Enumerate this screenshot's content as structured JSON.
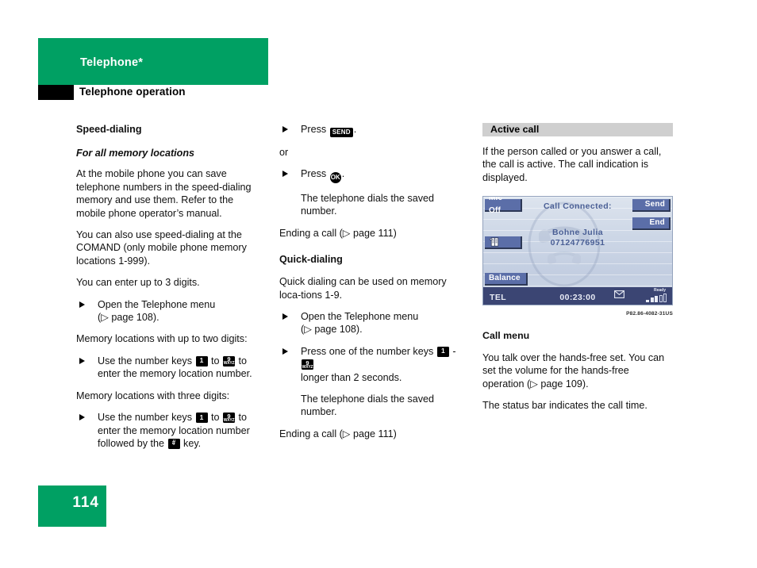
{
  "header": {
    "chapter": "Telephone*",
    "section": "Telephone operation"
  },
  "footer": {
    "page_number": "114"
  },
  "columns": {
    "left": {
      "heading": "Speed-dialing",
      "subheading": "For all memory locations",
      "para1": "At the mobile phone you can save telephone numbers in the speed-dialing memory and use them. Refer to the mobile phone operator’s manual.",
      "para2": "You can also use speed-dialing at the COMAND (only mobile phone memory locations 1-999).",
      "para3": "You can enter up to 3 digits.",
      "bullet1_line1": "Open the Telephone menu",
      "bullet1_line2": "(▷ page 108).",
      "para4": "Memory locations with up to two digits:",
      "bullet2_pre": "Use the number keys",
      "bullet2_mid": "to",
      "bullet2_post": "to",
      "bullet2_line2": "enter the memory location number.",
      "para5": "Memory locations with three digits:",
      "bullet3_pre": "Use the number keys",
      "bullet3_mid": "to",
      "bullet3_post": "to",
      "bullet3_line2": "enter the memory location number",
      "bullet3_line3_pre": "followed by the",
      "bullet3_line3_post": "key."
    },
    "middle": {
      "bullet1_pre": "Press",
      "bullet1_post": ".",
      "or_text": "or",
      "bullet2_pre": "Press",
      "bullet2_post": ".",
      "result1": "The telephone dials the saved number.",
      "ending1": "Ending a call (▷ page 111)",
      "heading": "Quick-dialing",
      "para1": "Quick dialing can be used on memory loca-tions 1-9.",
      "bullet3_line1": "Open the Telephone menu",
      "bullet3_line2": "(▷ page 108).",
      "bullet4_pre": "Press one of the number keys",
      "bullet4_mid": "-",
      "bullet4_line2": "longer than 2 seconds.",
      "result2": "The telephone dials the saved number.",
      "ending2": "Ending a call (▷ page 111)"
    },
    "right": {
      "box_header": "Active call",
      "para1": "If the person called or you answer a call, the call is active. The call indication is displayed.",
      "figure_code": "P82.86-4082-31US",
      "sub_heading": "Call menu",
      "para2": "You talk over the hands-free set. You can set the volume for the hands-free operation (▷ page 109).",
      "para3": "The status bar indicates the call time."
    }
  },
  "keys": {
    "key1_num": "1",
    "key9_num": "9",
    "key9_sub": "WXYZ",
    "hash_num": "#",
    "hash_sub": "°",
    "send_label": "SEND",
    "ok_label": "OK"
  },
  "comand_screen": {
    "btn_mic_off": "Mic Off",
    "btn_send": "Send",
    "btn_end": "End",
    "btn_balance": "Balance",
    "btn_phonebook_icon": "phonebook-icon",
    "title": "Call Connected:",
    "caller_name": "Bohne Julia",
    "caller_number": "07124776951",
    "status_mode": "TEL",
    "status_time": "00:23:00",
    "status_mail_icon": "envelope-icon",
    "status_ready": "Ready"
  },
  "colors": {
    "brand_green": "#00a063",
    "box_header_gray": "#cfcfcf",
    "screen_button": "#5b6ea8",
    "status_bar": "#3b4573",
    "screen_text": "#4a5f95"
  }
}
